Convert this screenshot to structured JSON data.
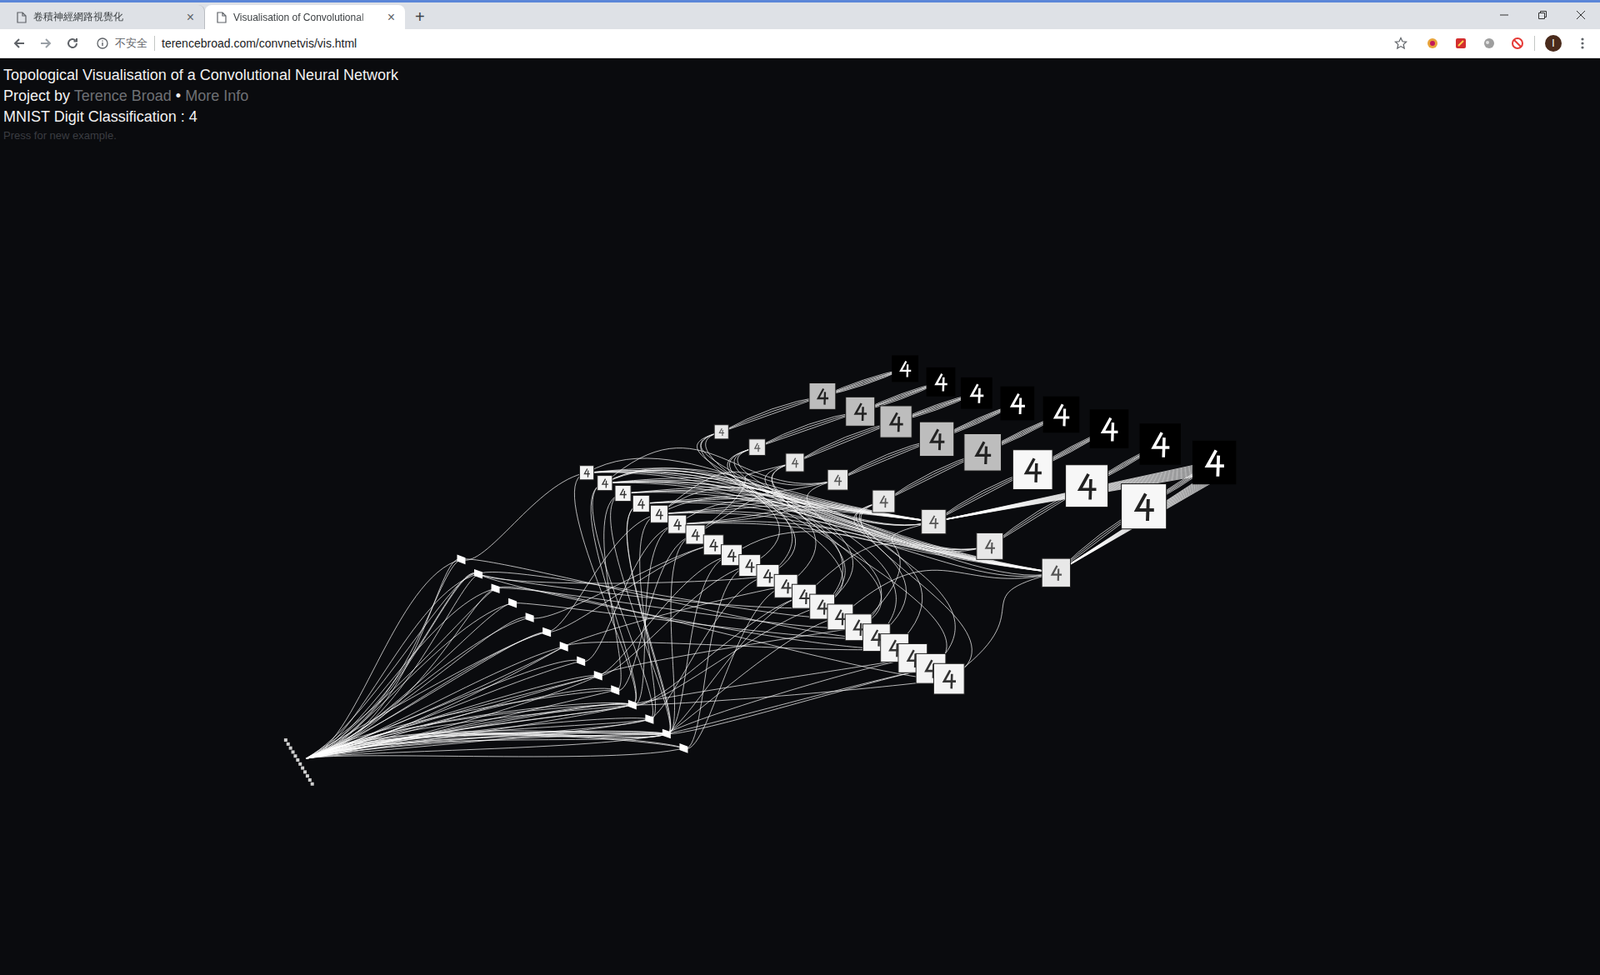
{
  "browser": {
    "tabs": [
      {
        "title": "卷積神經網路視覺化",
        "selected": false,
        "close": "×"
      },
      {
        "title": "Visualisation of Convolutional",
        "selected": true,
        "close": "×"
      }
    ],
    "new_tab": "+",
    "address_bar": {
      "security": "不安全",
      "url": "terencebroad.com/convnetvis/vis.html"
    },
    "profile": "I"
  },
  "page": {
    "title": "Topological Visualisation of a Convolutional Neural Network",
    "byline": {
      "prefix": "Project by",
      "author": "Terence Broad",
      "separator": "•",
      "more": "More Info"
    },
    "classification": "MNIST Digit Classification : 4",
    "hint": "Press for new example."
  }
}
